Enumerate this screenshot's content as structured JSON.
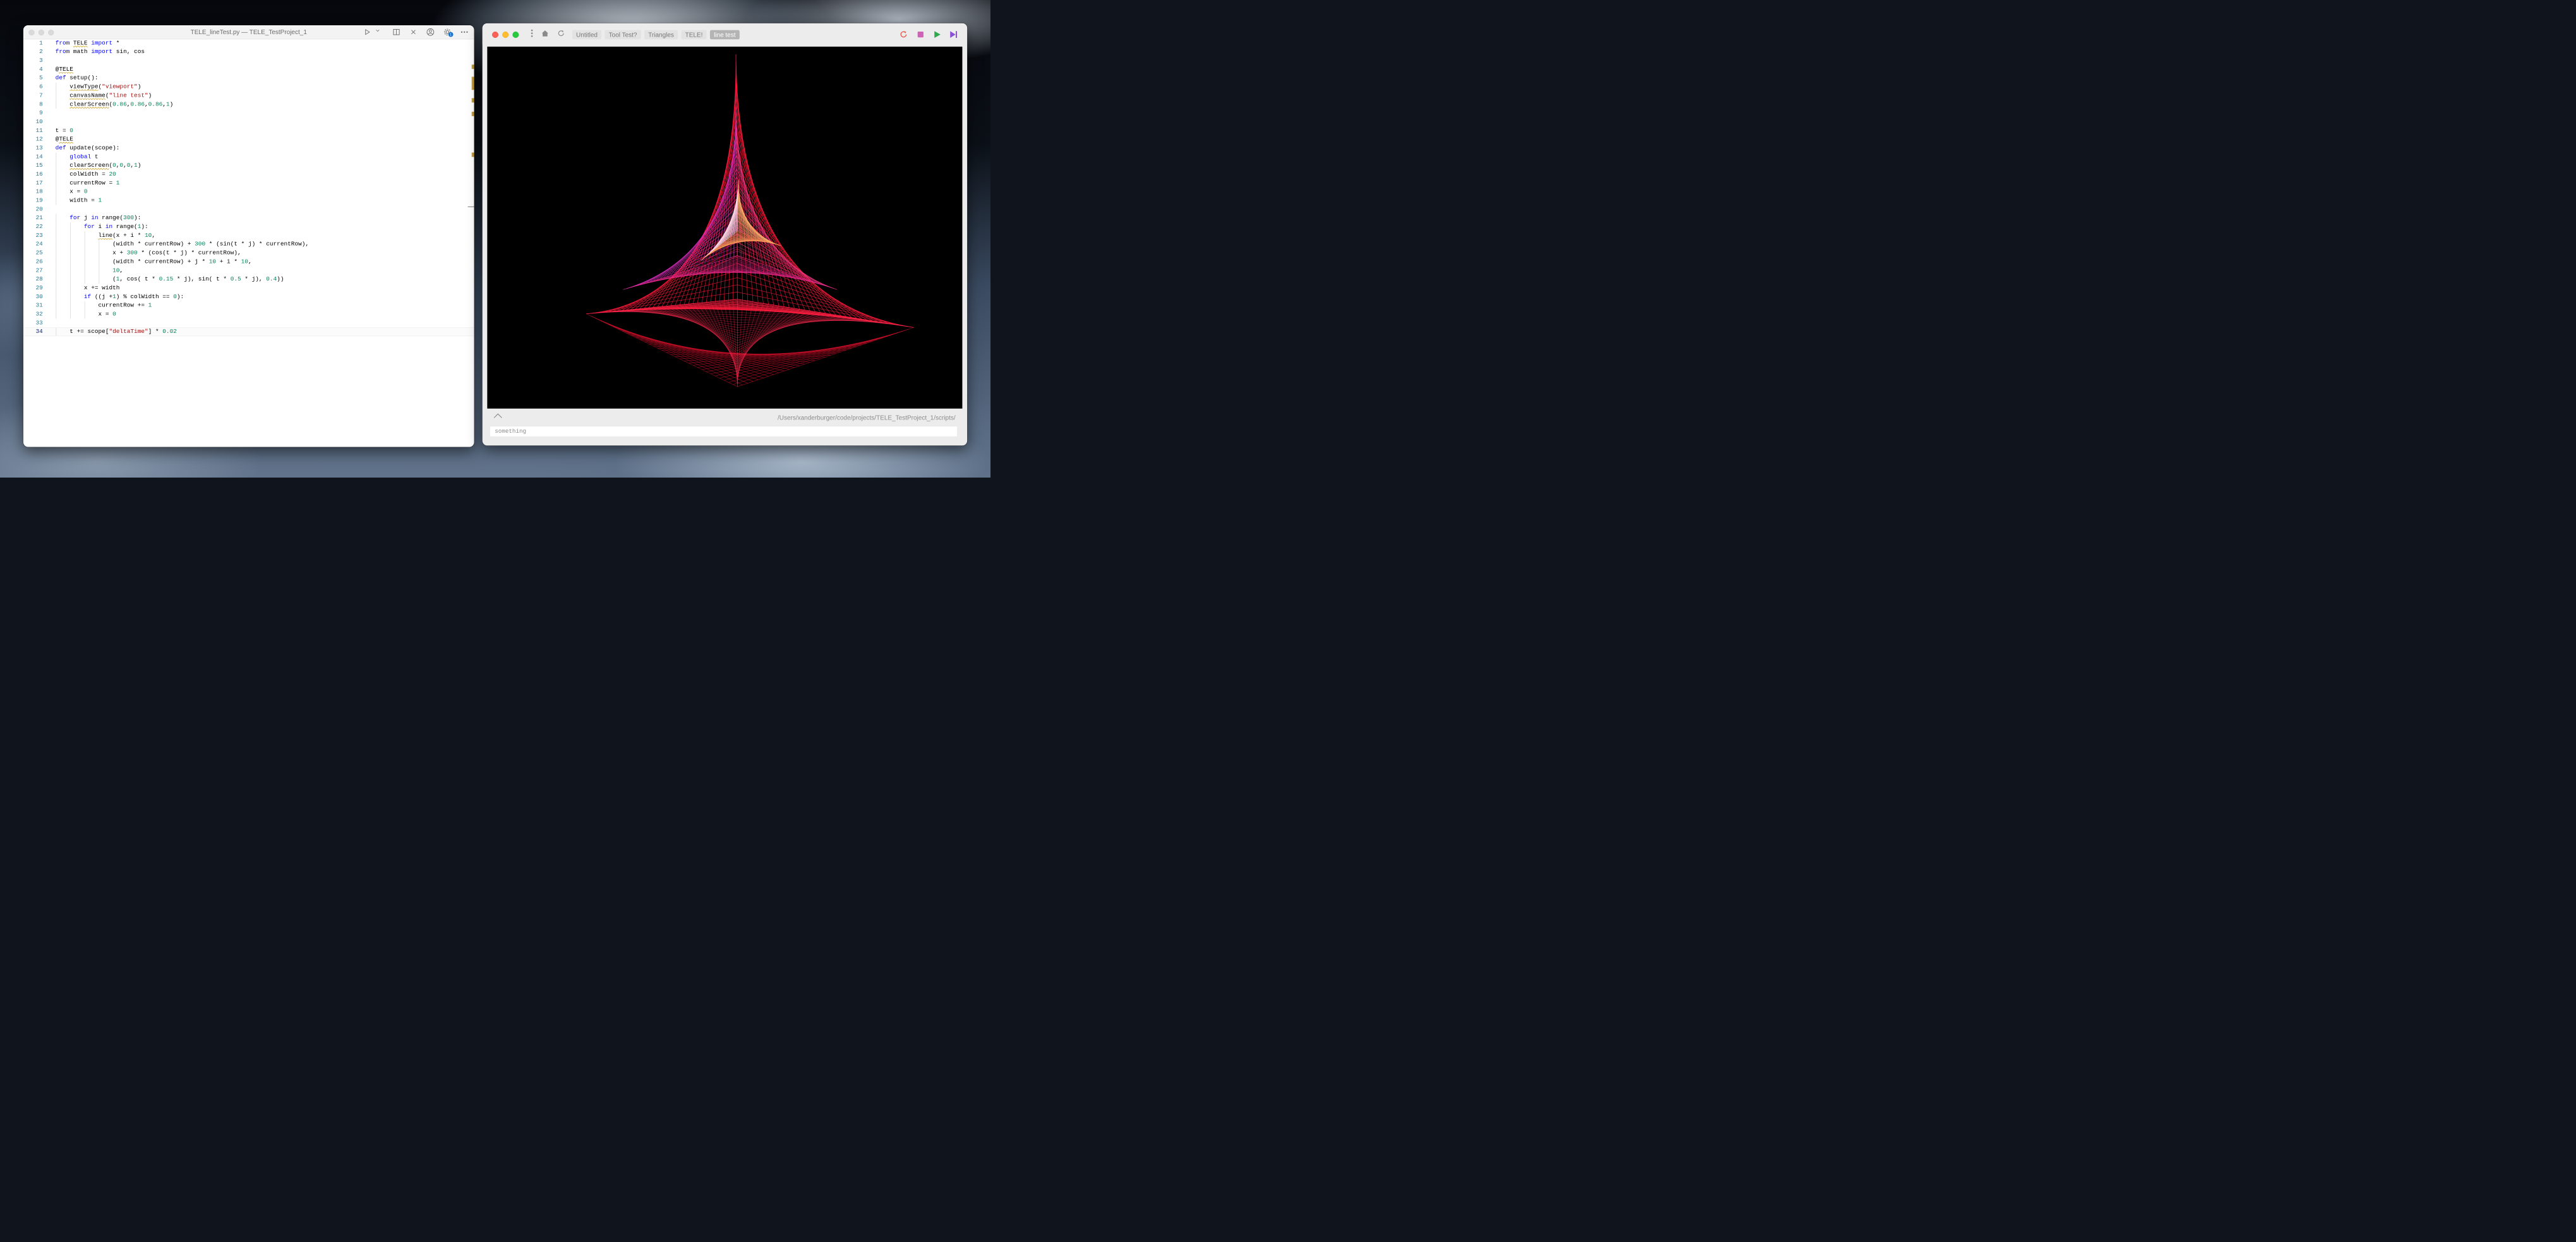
{
  "editor": {
    "title": "TELE_lineTest.py — TELE_TestProject_1",
    "notification_count": "1",
    "toolbar_icons": [
      "run-icon",
      "chevron-down-icon",
      "split-editor-icon",
      "close-icon",
      "account-icon",
      "gear-icon",
      "more-icon"
    ],
    "lines": [
      {
        "n": "1",
        "text": "from TELE import *"
      },
      {
        "n": "2",
        "text": "from math import sin, cos"
      },
      {
        "n": "3",
        "text": ""
      },
      {
        "n": "4",
        "text": "@TELE"
      },
      {
        "n": "5",
        "text": "def setup():"
      },
      {
        "n": "6",
        "text": "    viewType(\"viewport\")"
      },
      {
        "n": "7",
        "text": "    canvasName(\"line test\")"
      },
      {
        "n": "8",
        "text": "    clearScreen(0.86,0.86,0.86,1)"
      },
      {
        "n": "9",
        "text": ""
      },
      {
        "n": "10",
        "text": ""
      },
      {
        "n": "11",
        "text": "t = 0"
      },
      {
        "n": "12",
        "text": "@TELE"
      },
      {
        "n": "13",
        "text": "def update(scope):"
      },
      {
        "n": "14",
        "text": "    global t"
      },
      {
        "n": "15",
        "text": "    clearScreen(0,0,0,1)"
      },
      {
        "n": "16",
        "text": "    colWidth = 20"
      },
      {
        "n": "17",
        "text": "    currentRow = 1"
      },
      {
        "n": "18",
        "text": "    x = 0"
      },
      {
        "n": "19",
        "text": "    width = 1"
      },
      {
        "n": "20",
        "text": ""
      },
      {
        "n": "21",
        "text": "    for j in range(300):"
      },
      {
        "n": "22",
        "text": "        for i in range(1):"
      },
      {
        "n": "23",
        "text": "            line(x + i * 10,"
      },
      {
        "n": "24",
        "text": "                (width * currentRow) + 300 * (sin(t * j) * currentRow),"
      },
      {
        "n": "25",
        "text": "                x + 300 * (cos(t * j) * currentRow),"
      },
      {
        "n": "26",
        "text": "                (width * currentRow) + j * 10 + i * 10,"
      },
      {
        "n": "27",
        "text": "                10,"
      },
      {
        "n": "28",
        "text": "                (1, cos( t * 0.15 * j), sin( t * 0.5 * j), 0.4))"
      },
      {
        "n": "29",
        "text": "        x += width"
      },
      {
        "n": "30",
        "text": "        if ((j +1) % colWidth == 0):"
      },
      {
        "n": "31",
        "text": "            currentRow += 1"
      },
      {
        "n": "32",
        "text": "            x = 0"
      },
      {
        "n": "33",
        "text": ""
      },
      {
        "n": "34",
        "text": "    t += scope[\"deltaTime\"] * 0.02"
      }
    ]
  },
  "viewer": {
    "tabs": [
      {
        "label": "Untitled",
        "active": false
      },
      {
        "label": "Tool Test?",
        "active": false
      },
      {
        "label": "Triangles",
        "active": false
      },
      {
        "label": "TELE!",
        "active": false
      },
      {
        "label": "line test",
        "active": true
      }
    ],
    "nav_icons": [
      "more-vertical-icon",
      "home-icon",
      "reload-icon"
    ],
    "controls": [
      "refresh-icon",
      "stop-icon",
      "play-icon",
      "step-forward-icon"
    ],
    "colors": {
      "refresh": "#e25b4f",
      "stop": "#d063b8",
      "play": "#2fa84f",
      "step": "#8b4fd8",
      "stroke": "#ff1a3c"
    },
    "path": "/Users/xanderburger/code/projects/TELE_TestProject_1/scripts/",
    "input_value": "something"
  }
}
